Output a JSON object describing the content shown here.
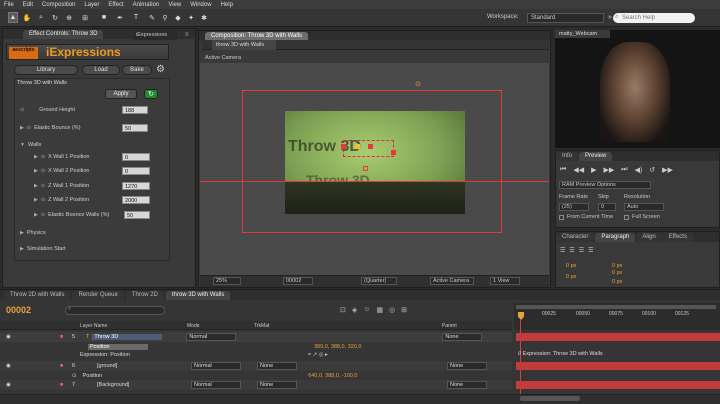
{
  "menu": [
    "File",
    "Edit",
    "Composition",
    "Layer",
    "Effect",
    "Animation",
    "View",
    "Window",
    "Help"
  ],
  "toolbar": {
    "tools": [
      "selection-tool",
      "hand-tool",
      "zoom-tool",
      "rotate-tool",
      "camera-tool",
      "pan-behind-tool",
      "rectangle-tool",
      "pen-tool",
      "text-tool",
      "brush-tool",
      "clone-tool",
      "eraser-tool",
      "roto-tool",
      "puppet-tool"
    ],
    "workspace_label": "Workspace:",
    "workspace_value": "Standard",
    "search_placeholder": "Search Help"
  },
  "effect_panel": {
    "tabs": [
      "Effect Controls: Throw 3D",
      ""
    ],
    "side_tab": "iExpressions",
    "logo_text": "aescripts",
    "title": "iExpressions",
    "buttons": {
      "library": "Library",
      "load": "Load",
      "bake": "Bake"
    },
    "group_title": "Throw 3D with Walls",
    "apply_label": "Apply",
    "props": [
      {
        "label": "Ground Height",
        "value": "188"
      },
      {
        "label": "Elastic Bounce (%)",
        "value": "50"
      },
      {
        "label": "Walls",
        "value": ""
      },
      {
        "label": "X Wall 1 Position",
        "value": "0"
      },
      {
        "label": "X Wall 2 Position",
        "value": "0"
      },
      {
        "label": "Z Wall 1 Position",
        "value": "1270"
      },
      {
        "label": "Z Wall 2 Position",
        "value": "2000"
      },
      {
        "label": "Elastic Bounce Walls (%)",
        "value": "50"
      },
      {
        "label": "Physics",
        "value": ""
      },
      {
        "label": "Simulation Start",
        "value": ""
      }
    ]
  },
  "composition": {
    "tab": "Composition: Throw 3D with Walls",
    "subtab": "throw 3D with Walls",
    "camera_label": "Active Camera",
    "scene_text": "Throw 3D",
    "footer": {
      "zoom": "25%",
      "timecode": "00002",
      "quality": "(Quarter)",
      "camera": "Active Camera",
      "views": "1 View"
    }
  },
  "webcam": {
    "tab": "matty_Webcam"
  },
  "preview": {
    "tabs": [
      "Info",
      "Preview"
    ],
    "ram_label": "RAM Preview Options",
    "frame_rate_label": "Frame Rate",
    "skip_label": "Skip",
    "resolution_label": "Resolution",
    "frame_rate": "(25)",
    "skip": "0",
    "resolution": "Auto",
    "from_current": "From Current Time",
    "full_screen": "Full Screen"
  },
  "paragraph": {
    "tabs": [
      "Character",
      "Paragraph",
      "Align",
      "Effects"
    ],
    "values": [
      "0 px",
      "0 px",
      "0 px",
      "0 px",
      "0 px"
    ]
  },
  "timeline": {
    "tabs": [
      "Throw 2D with Walls",
      "Render Queue",
      "Throw 2D",
      "throw 3D with Walls"
    ],
    "timecode": "00002",
    "columns": {
      "layer_name": "Layer Name",
      "mode": "Mode",
      "trkmat": "TrkMat",
      "parent": "Parent"
    },
    "ruler": [
      "00025",
      "00050",
      "00075",
      "00100",
      "00125"
    ],
    "layers": [
      {
        "num": "5",
        "name": "Throw 3D",
        "mode": "Normal",
        "parent": "None",
        "color": "#c23a3a"
      },
      {
        "num": "6",
        "name": "[ground]",
        "mode": "Normal",
        "trkmat": "None",
        "parent": "None",
        "color": "#c23a3a"
      },
      {
        "num": "7",
        "name": "[Background]",
        "mode": "Normal",
        "trkmat": "None",
        "parent": "None",
        "color": "#c23a3a"
      }
    ],
    "position_label": "Position",
    "position_value": "640,0, 388,0, -100,0",
    "position_value_top": "389,0, 388,0, 320,0",
    "expression_label": "Expression: Position",
    "expression_track": "// Expression: Throw 3D with Walls"
  }
}
